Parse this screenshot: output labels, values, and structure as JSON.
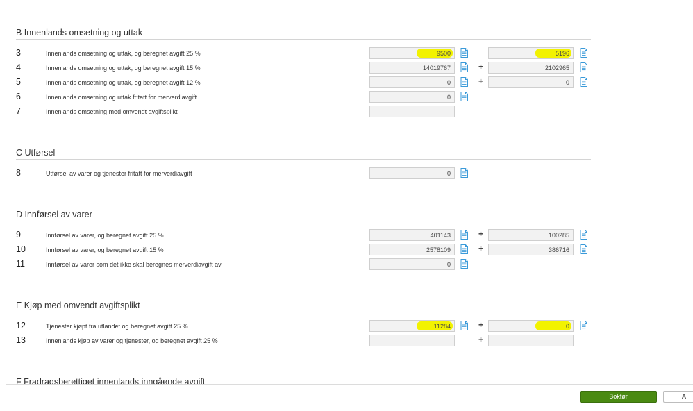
{
  "sections": {
    "b": {
      "title": "B Innenlands omsetning og uttak"
    },
    "c": {
      "title": "C Utførsel"
    },
    "d": {
      "title": "D Innførsel av varer"
    },
    "e": {
      "title": "E Kjøp med omvendt avgiftsplikt"
    },
    "f": {
      "title": "F Fradragsberettiget innenlands inngående avgift"
    }
  },
  "rows": {
    "r3": {
      "num": "3",
      "label": "Innenlands omsetning og uttak, og beregnet avgift 25 %",
      "value1": "9500",
      "value2": "5196"
    },
    "r4": {
      "num": "4",
      "label": "Innenlands omsetning og uttak, og beregnet avgift 15 %",
      "value1": "14019767",
      "value2": "2102965"
    },
    "r5": {
      "num": "5",
      "label": "Innenlands omsetning og uttak, og beregnet avgift 12 %",
      "value1": "0",
      "value2": "0"
    },
    "r6": {
      "num": "6",
      "label": "Innenlands omsetning og uttak fritatt for merverdiavgift",
      "value1": "0"
    },
    "r7": {
      "num": "7",
      "label": "Innenlands omsetning med omvendt avgiftsplikt",
      "value1": ""
    },
    "r8": {
      "num": "8",
      "label": "Utførsel av varer og tjenester fritatt for merverdiavgift",
      "value1": "0"
    },
    "r9": {
      "num": "9",
      "label": "Innførsel av varer, og beregnet avgift 25 %",
      "value1": "401143",
      "value2": "100285"
    },
    "r10": {
      "num": "10",
      "label": "Innførsel av varer, og beregnet avgift 15 %",
      "value1": "2578109",
      "value2": "386716"
    },
    "r11": {
      "num": "11",
      "label": "Innførsel av varer som det ikke skal beregnes merverdiavgift av",
      "value1": "0"
    },
    "r12": {
      "num": "12",
      "label": "Tjenester kjøpt fra utlandet og beregnet avgift 25 %",
      "value1": "11284",
      "value2": "0"
    },
    "r13": {
      "num": "13",
      "label": "Innenlands kjøp av varer og tjenester, og beregnet avgift 25 %",
      "value1": "",
      "value2": ""
    }
  },
  "plus_sign": "+",
  "footer": {
    "bokfor_label": "Bokfør",
    "other_label": "A"
  },
  "icons": {
    "document": "document-icon"
  },
  "colors": {
    "accent_green": "#4a8a12",
    "highlight": "#f2f200",
    "doc_icon": "#3a9ad9"
  }
}
